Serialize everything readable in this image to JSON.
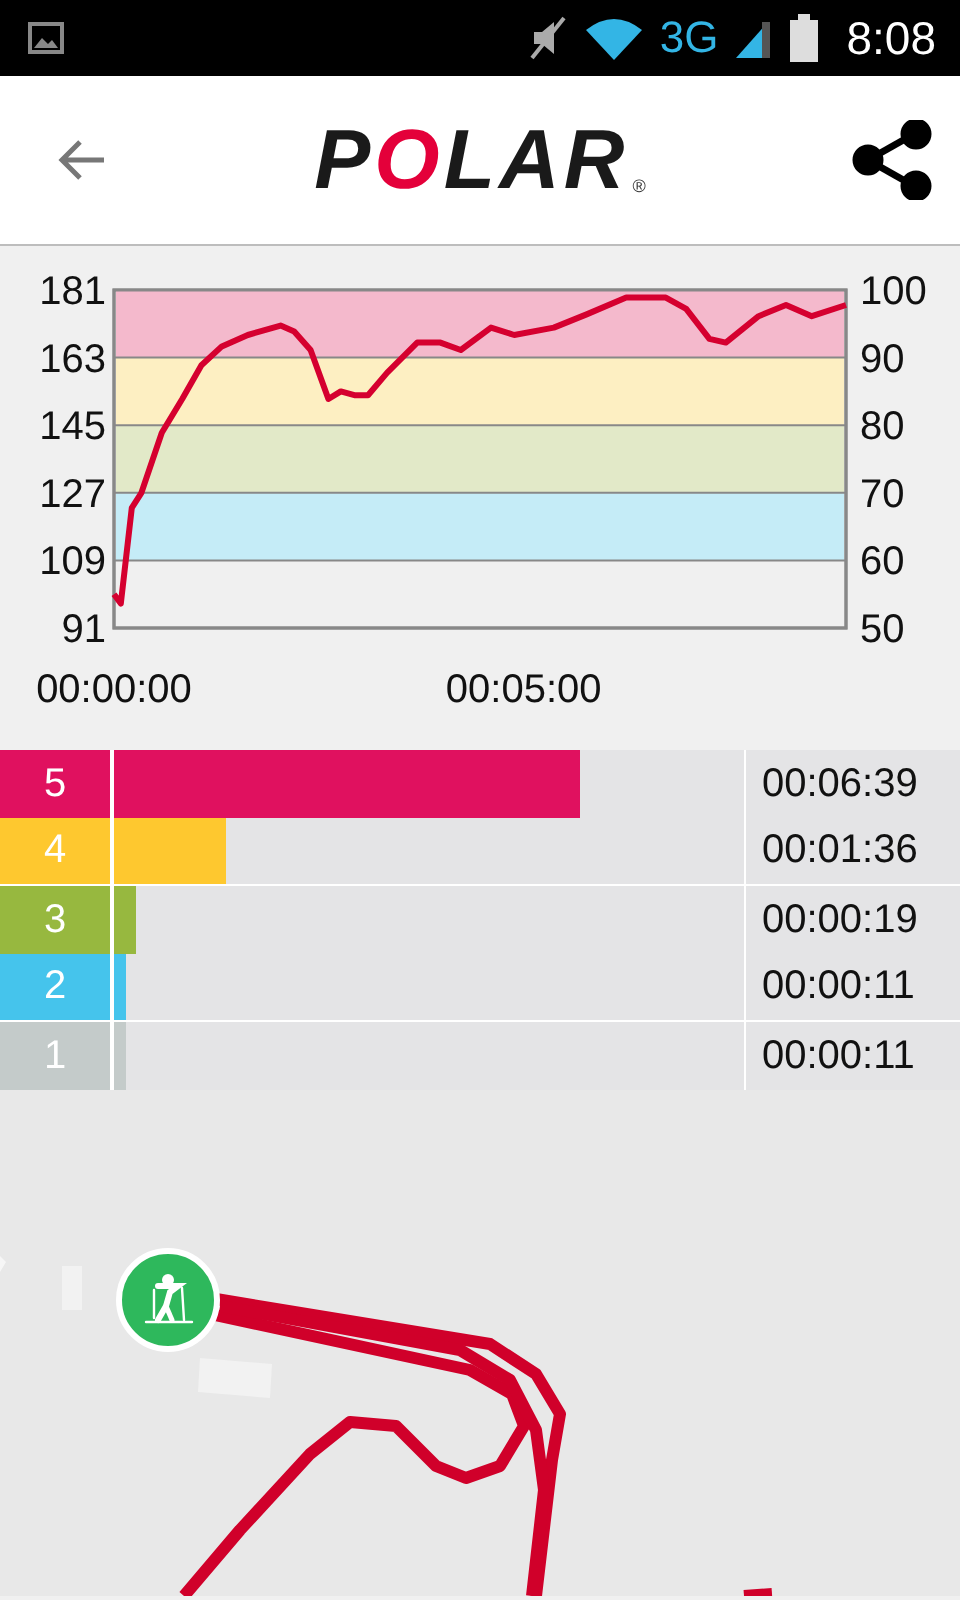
{
  "status_bar": {
    "network": "3G",
    "time": "8:08"
  },
  "header": {
    "logo": "POLAR",
    "logo_mark": "®"
  },
  "chart": {
    "chart_data": {
      "type": "line",
      "ylim": [
        91,
        181
      ],
      "yticks": [
        91,
        109,
        127,
        145,
        163,
        181
      ],
      "y2lim": [
        50,
        100
      ],
      "y2ticks": [
        50,
        60,
        70,
        80,
        90,
        100
      ],
      "xlim": [
        0,
        536
      ],
      "xticks": [
        {
          "value": 0,
          "label": "00:00:00"
        },
        {
          "value": 300,
          "label": "00:05:00"
        }
      ],
      "grid": true,
      "bands": [
        {
          "axis": "y",
          "from": 109,
          "to": 127,
          "color": "#c5ecf7"
        },
        {
          "axis": "y",
          "from": 127,
          "to": 145,
          "color": "#e2e9c8"
        },
        {
          "axis": "y",
          "from": 145,
          "to": 163,
          "color": "#fdefc2"
        },
        {
          "axis": "y",
          "from": 163,
          "to": 181,
          "color": "#f4b9cc"
        }
      ],
      "x": [
        0,
        5,
        13,
        20,
        35,
        50,
        64,
        79,
        98,
        122,
        132,
        144,
        157,
        166,
        176,
        186,
        200,
        222,
        239,
        254,
        276,
        293,
        322,
        346,
        375,
        404,
        419,
        436,
        448,
        472,
        492,
        511,
        536
      ],
      "series": [
        {
          "color": "#d5002f",
          "values": [
            100,
            97.5,
            123,
            127,
            143,
            152,
            161,
            166,
            169,
            171.5,
            170,
            165,
            152,
            154,
            153,
            153,
            159,
            167,
            167,
            165,
            171,
            169,
            171,
            174.5,
            179,
            179,
            176,
            168,
            167,
            174,
            177,
            174,
            177
          ]
        }
      ]
    }
  },
  "zones": [
    {
      "label": "5",
      "color": "#e0115f",
      "time": "00:06:39"
    },
    {
      "label": "4",
      "color": "#fec82f",
      "time": "00:01:36"
    },
    {
      "label": "3",
      "color": "#97b83f",
      "time": "00:00:19"
    },
    {
      "label": "2",
      "color": "#45c4ec",
      "time": "00:00:11"
    },
    {
      "label": "1",
      "color": "#c4cbca",
      "time": "00:00:11"
    }
  ]
}
